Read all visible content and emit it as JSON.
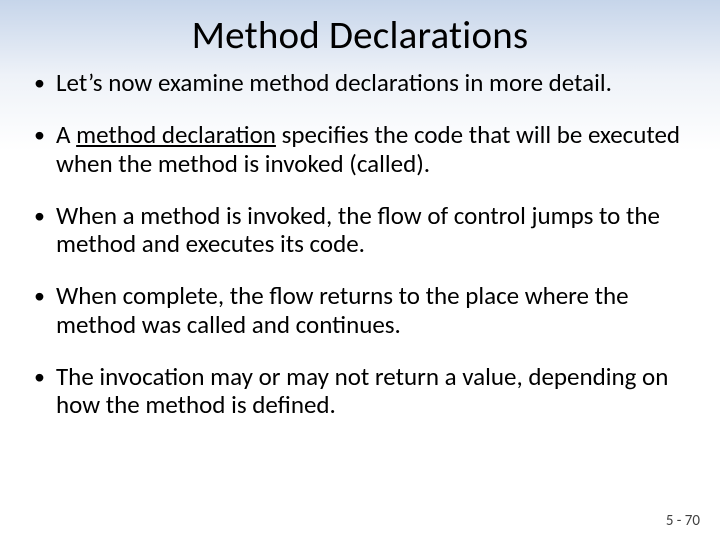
{
  "title": "Method Declarations",
  "bullets": {
    "b1": "Let’s now examine method declarations in more detail.",
    "b2a": "A ",
    "b2u": "method declaration",
    "b2b": " specifies the code that will be executed when the method is invoked (called).",
    "b3": "When a method is invoked, the flow of control jumps to the method and executes its code.",
    "b4": "When complete, the flow returns to the place where the method was called and continues.",
    "b5": "The invocation may or may not return a value, depending on how the method is defined."
  },
  "pagenum": "5 - 70"
}
